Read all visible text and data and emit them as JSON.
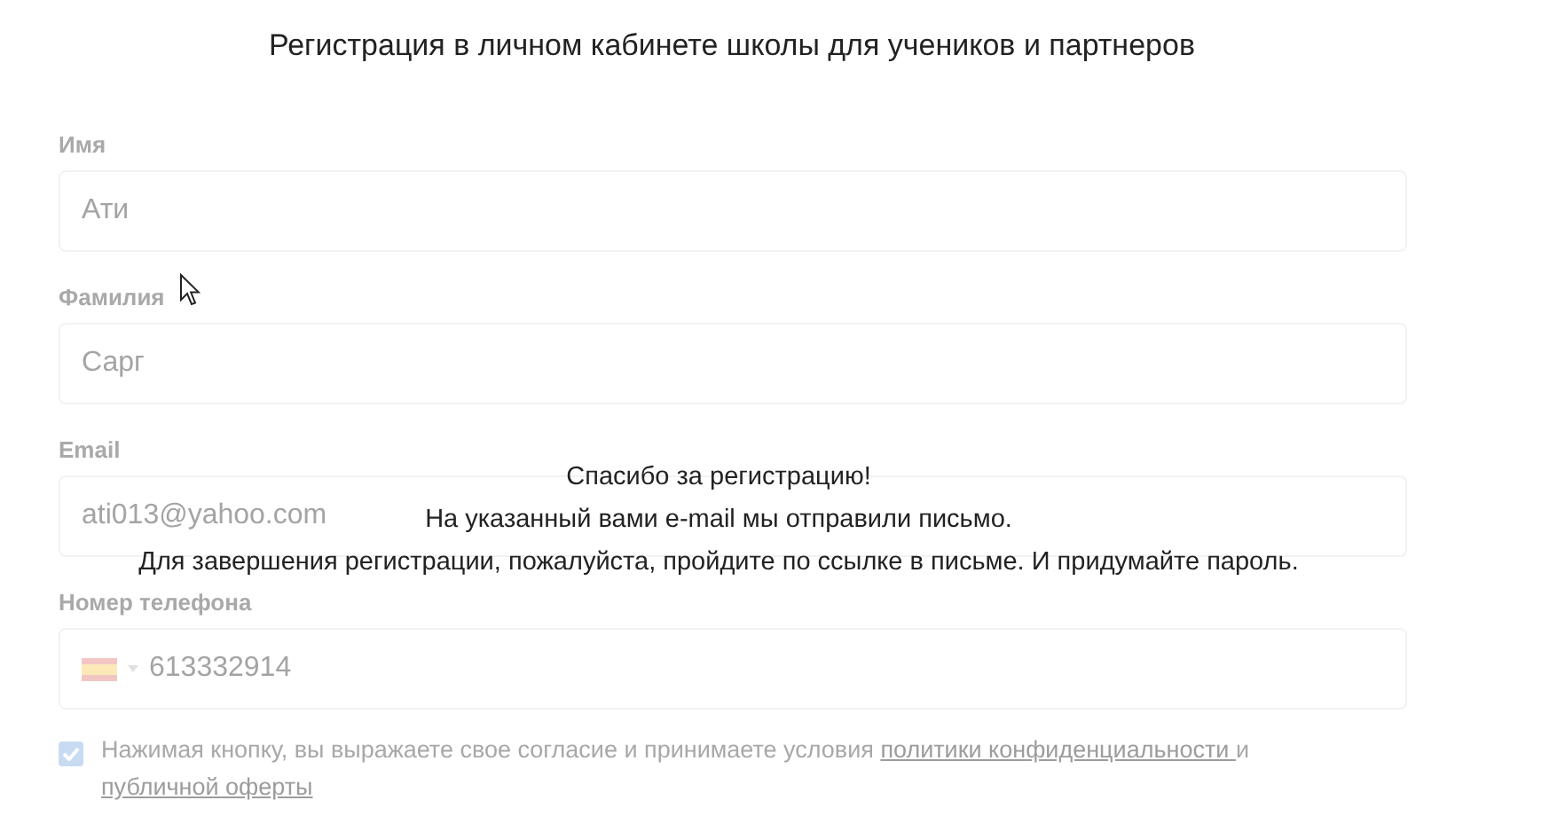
{
  "title": "Регистрация в личном кабинете школы для учеников и партнеров",
  "fields": [
    {
      "kind": "text",
      "label": "Имя",
      "value": "Ати"
    },
    {
      "kind": "text",
      "label": "Фамилия",
      "value": "Сарг"
    },
    {
      "kind": "text",
      "label": "Email",
      "value": "ati013@yahoo.com"
    },
    {
      "kind": "phone",
      "label": "Номер телефона",
      "value": "613332914"
    }
  ],
  "consent": {
    "checked": true,
    "parts": [
      {
        "kind": "text",
        "text": "Нажимая кнопку, вы выражаете свое согласие и принимаете условия "
      },
      {
        "kind": "link",
        "text": "политики конфиденциальности "
      },
      {
        "kind": "text",
        "text": "и "
      },
      {
        "kind": "link",
        "text": "публичной оферты"
      }
    ]
  },
  "message": [
    "Спасибо за регистрацию!",
    "На указанный вами e-mail мы отправили письмо.",
    "Для завершения регистрации, пожалуйста, пройдите по ссылке в письме. И придумайте пароль."
  ]
}
